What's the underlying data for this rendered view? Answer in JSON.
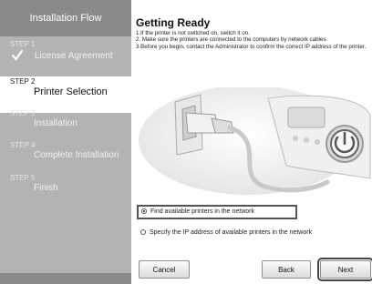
{
  "sidebar": {
    "title": "Installation Flow",
    "steps": [
      {
        "num": "STEP 1",
        "label": "License Agreement",
        "state": "done"
      },
      {
        "num": "STEP 2",
        "label": "Printer Selection",
        "state": "current"
      },
      {
        "num": "STEP 3",
        "label": "Installation",
        "state": "pending"
      },
      {
        "num": "STEP 4",
        "label": "Complete Installation",
        "state": "pending"
      },
      {
        "num": "STEP 5",
        "label": "Finish",
        "state": "pending"
      }
    ]
  },
  "main": {
    "title": "Getting Ready",
    "instructions": [
      "1.If the printer is not switched on, switch it on.",
      "2. Make sure the printers are connected to the computers by network cables.",
      "3.Before you begin, contact the Administrator to confirm the correct IP address of the printer."
    ],
    "options": [
      {
        "label": "Find available printers in the network",
        "selected": true
      },
      {
        "label": "Specify the IP address of available printers in the network",
        "selected": false
      }
    ],
    "buttons": {
      "cancel": "Cancel",
      "back": "Back",
      "next": "Next"
    }
  },
  "colors": {
    "sidebar_bg": "#b3b3b3",
    "sidebar_header": "#8a8a8a",
    "current_step_bg": "#ffffff"
  }
}
